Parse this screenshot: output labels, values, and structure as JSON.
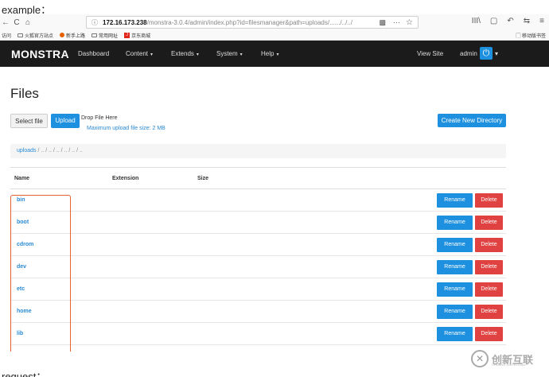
{
  "captions": {
    "top": "example：",
    "bottom": "request："
  },
  "browser": {
    "back": "←",
    "reload": "C",
    "home": "⌂",
    "info_icon": "ⓘ",
    "url_host": "172.16.173.238",
    "url_path": "/monstra-3.0.4/admin/index.php?id=filesmanager&path=uploads/....../../../",
    "more": "···",
    "star": "☆",
    "tools": [
      "III\\",
      "▢",
      "↶",
      "⇆",
      "≡"
    ],
    "bookmarks": [
      "访问",
      "火狐官方站点",
      "新手上路",
      "常用网址",
      "京东商城"
    ],
    "bookmark_right": "▢ 移动版书签"
  },
  "app": {
    "brand": "MONSTRA",
    "nav": [
      "Dashboard",
      "Content",
      "Extends",
      "System",
      "Help"
    ],
    "view_site": "View Site",
    "user": "admin",
    "power_icon": "⏻"
  },
  "page": {
    "title": "Files",
    "select_file": "Select file",
    "upload": "Upload",
    "drop_text": "Drop File Here",
    "max_upload": "Maximum upload file size: 2 MB",
    "create_dir": "Create New Directory",
    "breadcrumb_root": "uploads",
    "breadcrumb_rest": " / .. / .. / .. / .. / .. / .."
  },
  "table": {
    "headers": [
      "Name",
      "Extension",
      "Size"
    ],
    "rows": [
      "bin",
      "boot",
      "cdrom",
      "dev",
      "etc",
      "home",
      "lib"
    ],
    "rename": "Rename",
    "delete": "Delete"
  },
  "watermark": {
    "mark": "✕",
    "text": "创新互联",
    "sub": "CHUANG XIN HU LIAN"
  },
  "colors": {
    "primary": "#1e90e0",
    "danger": "#e04242",
    "navbar": "#1b1b1b",
    "highlight": "#e8622c"
  }
}
